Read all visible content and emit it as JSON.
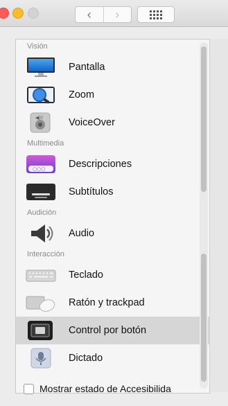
{
  "toolbar": {
    "back_glyph": "‹",
    "forward_glyph": "›",
    "show_all_icon": "grid-icon"
  },
  "sidebar": {
    "sections": [
      {
        "label": "Visión",
        "items": [
          {
            "label": "Pantalla",
            "icon": "display-icon"
          },
          {
            "label": "Zoom",
            "icon": "zoom-icon"
          },
          {
            "label": "VoiceOver",
            "icon": "voiceover-icon"
          }
        ]
      },
      {
        "label": "Multimedia",
        "items": [
          {
            "label": "Descripciones",
            "icon": "descriptions-icon"
          },
          {
            "label": "Subtítulos",
            "icon": "subtitles-icon"
          }
        ]
      },
      {
        "label": "Audición",
        "items": [
          {
            "label": "Audio",
            "icon": "speaker-icon"
          }
        ]
      },
      {
        "label": "Interacción",
        "items": [
          {
            "label": "Teclado",
            "icon": "keyboard-icon"
          },
          {
            "label": "Ratón y trackpad",
            "icon": "mouse-trackpad-icon"
          },
          {
            "label": "Control por botón",
            "icon": "switch-control-icon",
            "selected": true
          },
          {
            "label": "Dictado",
            "icon": "microphone-icon"
          }
        ]
      }
    ]
  },
  "footer": {
    "checkbox_label": "Mostrar estado de Accesibilida",
    "checked": false
  },
  "colors": {
    "selected_row": "#d6d6d6",
    "close": "#fc5b57",
    "minimize": "#f8bb2d"
  }
}
